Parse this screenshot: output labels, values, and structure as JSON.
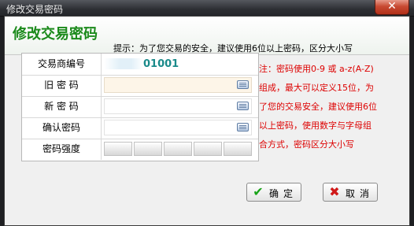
{
  "window": {
    "title": "修改交易密码"
  },
  "banner": {
    "heading": "修改交易密码",
    "hint": "提示：为了您交易的安全，建议使用6位以上密码，区分大小写"
  },
  "form": {
    "account": {
      "label": "交易商编号",
      "value": "01001"
    },
    "old_password": {
      "label": "旧 密 码",
      "value": ""
    },
    "new_password": {
      "label": "新 密 码",
      "value": ""
    },
    "confirm_password": {
      "label": "确认密码",
      "value": ""
    },
    "strength": {
      "label": "密码强度",
      "segments": 5,
      "level": 0
    }
  },
  "note": {
    "lines": [
      "注：密码使用0-9 或 a-z(A-Z)",
      "组成，最大可以定义15位，为",
      "了您的交易安全，建议使用6位",
      "以上密码，使用数字与字母组",
      "合方式，密码区分大小写"
    ]
  },
  "buttons": {
    "ok": "确定",
    "cancel": "取消"
  },
  "colors": {
    "heading": "#1b8a1b",
    "note": "#dd0000",
    "account_value": "#1a8a8a"
  },
  "icons": {
    "keyboard": "keyboard-icon",
    "ok": "checkmark-icon",
    "cancel": "cross-icon",
    "close": "close-icon"
  }
}
